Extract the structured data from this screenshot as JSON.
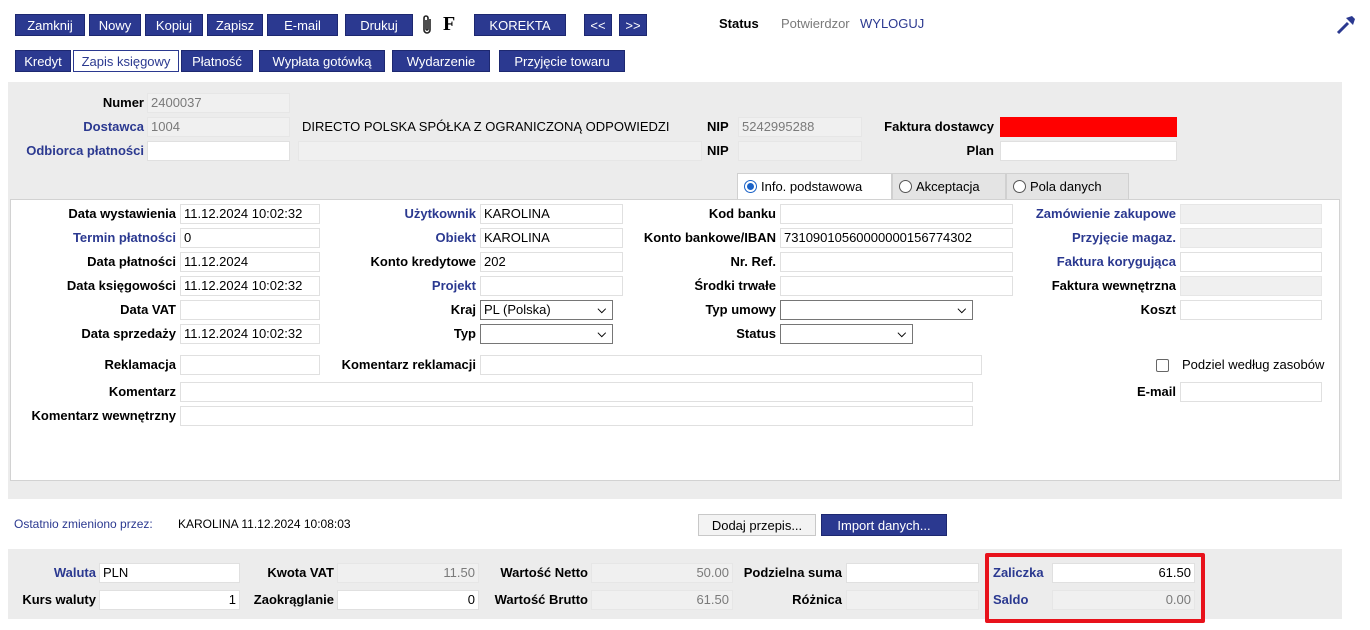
{
  "toolbar": {
    "buttons": [
      "Zamknij",
      "Nowy",
      "Kopiuj",
      "Zapisz",
      "E-mail",
      "Drukuj"
    ],
    "f_label": "F",
    "korekta": "KOREKTA",
    "prev": "<<",
    "next": ">>",
    "status_label": "Status",
    "status_value": "Potwierdzor",
    "logout": "WYLOGUJ"
  },
  "second_bar": [
    "Kredyt",
    "Zapis księgowy",
    "Płatność",
    "Wypłata gotówką",
    "Wydarzenie",
    "Przyjęcie towaru"
  ],
  "header": {
    "numer_label": "Numer",
    "numer_value": "2400037",
    "dostawca_label": "Dostawca",
    "dostawca_value": "1004",
    "dostawca_name": "DIRECTO POLSKA SPÓŁKA Z OGRANICZONĄ ODPOWIEDZI",
    "nip_label": "NIP",
    "nip_value": "5242995288",
    "faktura_label": "Faktura dostawcy",
    "odbiorca_label": "Odbiorca płatności",
    "nip2_label": "NIP",
    "plan_label": "Plan"
  },
  "tabs": [
    "Info. podstawowa",
    "Akceptacja",
    "Pola danych"
  ],
  "form": {
    "data_wystawienia_label": "Data wystawienia",
    "data_wystawienia": "11.12.2024 10:02:32",
    "termin_label": "Termin płatności",
    "termin": "0",
    "data_platnosci_label": "Data płatności",
    "data_platnosci": "11.12.2024",
    "data_ksieg_label": "Data księgowości",
    "data_ksieg": "11.12.2024 10:02:32",
    "data_vat_label": "Data VAT",
    "data_sprzedazy_label": "Data sprzedaży",
    "data_sprzedazy": "11.12.2024 10:02:32",
    "uzytkownik_label": "Użytkownik",
    "uzytkownik": "KAROLINA",
    "obiekt_label": "Obiekt",
    "obiekt": "KAROLINA",
    "konto_kred_label": "Konto kredytowe",
    "konto_kred": "202",
    "projekt_label": "Projekt",
    "kraj_label": "Kraj",
    "kraj": "PL (Polska)",
    "typ_label": "Typ",
    "kod_banku_label": "Kod banku",
    "konto_iban_label": "Konto bankowe/IBAN",
    "konto_iban": "73109010560000000156774302",
    "nr_ref_label": "Nr. Ref.",
    "srodki_label": "Środki trwałe",
    "typ_umowy_label": "Typ umowy",
    "status_label": "Status",
    "zamowienie_label": "Zamówienie zakupowe",
    "przyjecie_label": "Przyjęcie magaz.",
    "faktura_kor_label": "Faktura korygująca",
    "faktura_wew_label": "Faktura wewnętrzna",
    "koszt_label": "Koszt",
    "reklamacja_label": "Reklamacja",
    "komentarz_rekl_label": "Komentarz reklamacji",
    "podziel_label": "Podziel według zasobów",
    "komentarz_label": "Komentarz",
    "email_label": "E-mail",
    "komentarz_wew_label": "Komentarz wewnętrzny"
  },
  "footer": {
    "changed_label": "Ostatnio zmieniono przez:",
    "changed_value": "KAROLINA 11.12.2024 10:08:03",
    "dodaj": "Dodaj przepis...",
    "import": "Import danych..."
  },
  "totals": {
    "waluta_label": "Waluta",
    "waluta": "PLN",
    "kurs_label": "Kurs waluty",
    "kurs": "1",
    "kwota_vat_label": "Kwota VAT",
    "kwota_vat": "11.50",
    "zaokr_label": "Zaokrąglanie",
    "zaokr": "0",
    "netto_label": "Wartość Netto",
    "netto": "50.00",
    "brutto_label": "Wartość Brutto",
    "brutto": "61.50",
    "podzielna_label": "Podzielna suma",
    "roznica_label": "Różnica",
    "zaliczka_label": "Zaliczka",
    "zaliczka": "61.50",
    "saldo_label": "Saldo",
    "saldo": "0.00"
  },
  "colors": {
    "primary": "#2b3990",
    "highlight": "#e8121b",
    "required": "#ff0000"
  }
}
